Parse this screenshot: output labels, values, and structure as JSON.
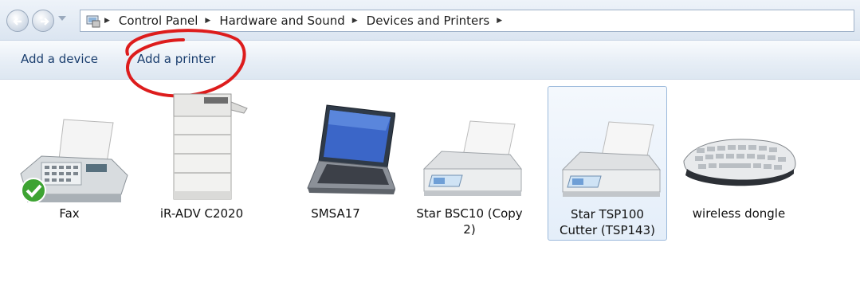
{
  "breadcrumb": {
    "items": [
      "Control Panel",
      "Hardware and Sound",
      "Devices and Printers"
    ]
  },
  "commands": {
    "add_device": "Add a device",
    "add_printer": "Add a printer"
  },
  "devices": [
    {
      "label": "Fax",
      "icon": "fax-icon",
      "default": true
    },
    {
      "label": "iR-ADV C2020",
      "icon": "copier-icon"
    },
    {
      "label": "SMSA17",
      "icon": "laptop-icon"
    },
    {
      "label": "Star BSC10 (Copy 2)",
      "icon": "printer-icon"
    },
    {
      "label": "Star TSP100 Cutter (TSP143)",
      "icon": "printer-icon",
      "selected": true
    },
    {
      "label": "wireless dongle",
      "icon": "keyboard-icon"
    }
  ],
  "colors": {
    "annotation": "#dd1c1c",
    "link": "#1a3e6e",
    "selection_border": "#9cbadc"
  }
}
